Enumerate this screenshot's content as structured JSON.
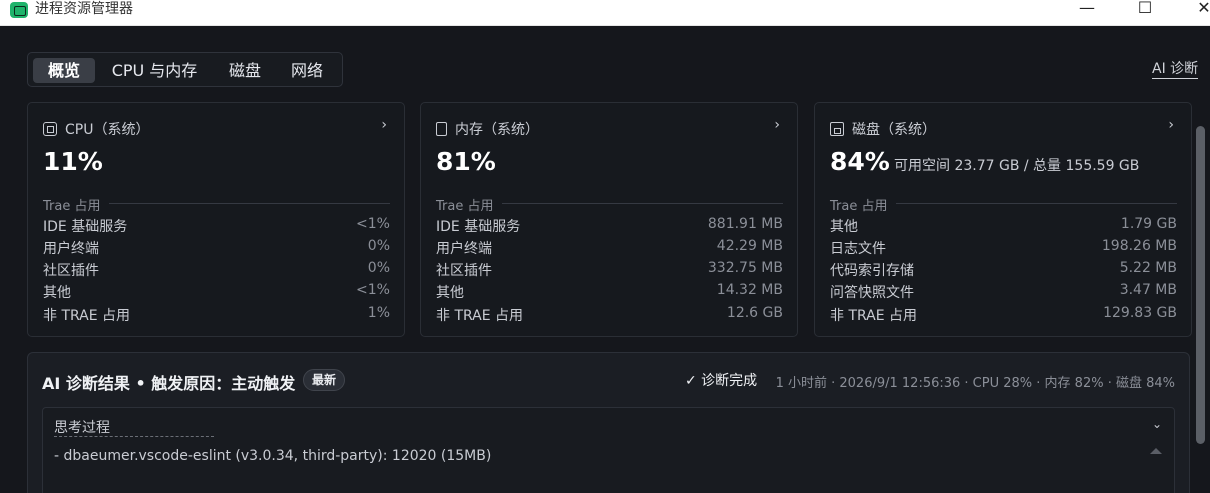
{
  "window": {
    "title": "进程资源管理器",
    "minimize": "—",
    "maximize": "☐",
    "close": "✕"
  },
  "tabs": [
    {
      "label": "概览",
      "active": true
    },
    {
      "label": "CPU 与内存",
      "active": false
    },
    {
      "label": "磁盘",
      "active": false
    },
    {
      "label": "网络",
      "active": false
    }
  ],
  "ai_link": "AI 诊断",
  "cards": {
    "cpu": {
      "title": "CPU（系统）",
      "icon": "cpu-icon",
      "value": "11%",
      "group": "Trae 占用",
      "rows": [
        {
          "k": "IDE 基础服务",
          "v": "<1%"
        },
        {
          "k": "用户终端",
          "v": "0%"
        },
        {
          "k": "社区插件",
          "v": "0%"
        },
        {
          "k": "其他",
          "v": "<1%"
        },
        {
          "k": "非 TRAE 占用",
          "v": "1%"
        }
      ]
    },
    "memory": {
      "title": "内存（系统）",
      "icon": "memory-icon",
      "value": "81%",
      "group": "Trae 占用",
      "rows": [
        {
          "k": "IDE 基础服务",
          "v": "881.91 MB"
        },
        {
          "k": "用户终端",
          "v": "42.29 MB"
        },
        {
          "k": "社区插件",
          "v": "332.75 MB"
        },
        {
          "k": "其他",
          "v": "14.32 MB"
        },
        {
          "k": "非 TRAE 占用",
          "v": "12.6 GB"
        }
      ]
    },
    "disk": {
      "title": "磁盘（系统）",
      "icon": "disk-icon",
      "value": "84%",
      "sub": "可用空间 23.77 GB / 总量 155.59 GB",
      "group": "Trae 占用",
      "rows": [
        {
          "k": "其他",
          "v": "1.79 GB"
        },
        {
          "k": "日志文件",
          "v": "198.26 MB"
        },
        {
          "k": "代码索引存储",
          "v": "5.22 MB"
        },
        {
          "k": "问答快照文件",
          "v": "3.47 MB"
        },
        {
          "k": "非 TRAE 占用",
          "v": "129.83 GB"
        }
      ]
    }
  },
  "diagnosis": {
    "title": "AI 诊断结果 • 触发原因：主动触发",
    "badge": "最新",
    "status": "✓ 诊断完成",
    "meta": "1 小时前 · 2026/9/1 12:56:36 · CPU 28% · 内存 82% · 磁盘 84%",
    "thinking_label": "思考过程",
    "thinking_text": "- dbaeumer.vscode-eslint (v3.0.34, third-party): 12020 (15MB)"
  },
  "colors": {
    "background": "#15171c",
    "card": "#16191e",
    "accent_icon": "#1fb36b"
  }
}
